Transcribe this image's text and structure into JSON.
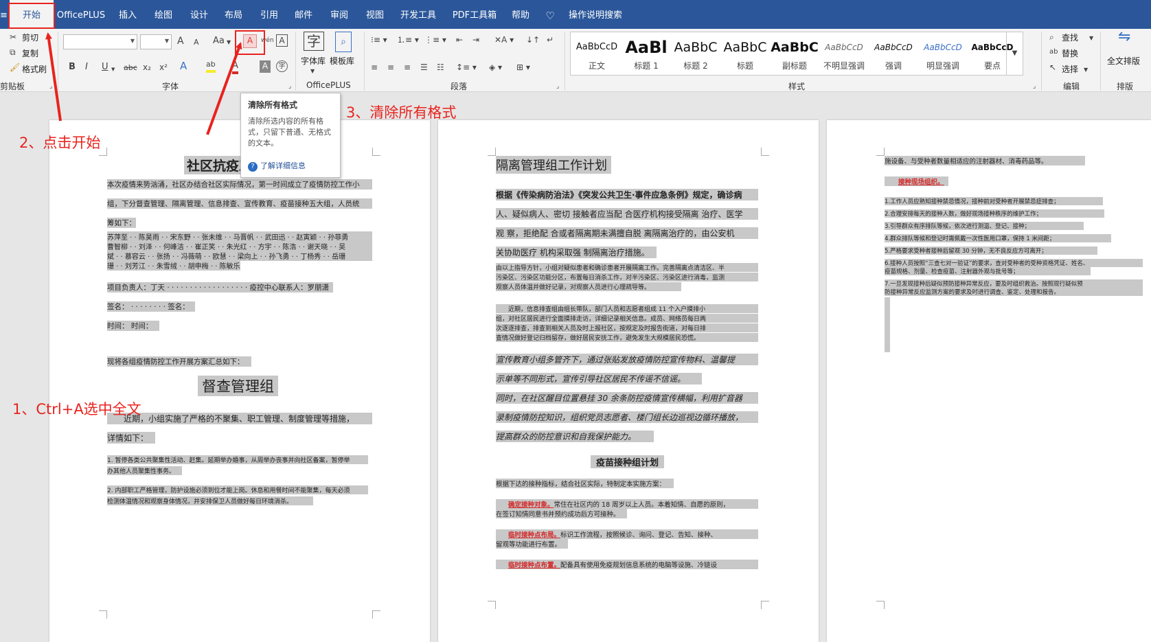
{
  "tabs": [
    "开始",
    "OfficePLUS",
    "插入",
    "绘图",
    "设计",
    "布局",
    "引用",
    "邮件",
    "审阅",
    "视图",
    "开发工具",
    "PDF工具箱",
    "帮助",
    "操作说明搜索"
  ],
  "clipboard": {
    "cut": "剪切",
    "copy": "复制",
    "painter": "格式刷",
    "label": "剪贴板"
  },
  "font": {
    "label": "字体",
    "name_value": "",
    "size_value": "",
    "grow": "A",
    "shrink": "A",
    "case": "Aa",
    "bold": "B",
    "italic": "I",
    "underline": "U",
    "strike": "abc",
    "sub": "x₂",
    "sup": "x²"
  },
  "officeplus": {
    "lib": "字体库",
    "tpl": "模板库",
    "label": "OfficePLUS"
  },
  "paragraph": {
    "label": "段落"
  },
  "styles": {
    "label": "样式",
    "items": [
      {
        "preview": "AaBbCcD",
        "name": "正文"
      },
      {
        "preview": "AaBl",
        "name": "标题 1"
      },
      {
        "preview": "AaBbC",
        "name": "标题 2"
      },
      {
        "preview": "AaBbC",
        "name": "标题"
      },
      {
        "preview": "AaBbC",
        "name": "副标题"
      },
      {
        "preview": "AaBbCcD",
        "name": "不明显强调"
      },
      {
        "preview": "AaBbCcD",
        "name": "强调"
      },
      {
        "preview": "AaBbCcD",
        "name": "明显强调"
      },
      {
        "preview": "AaBbCcD",
        "name": "要点"
      }
    ]
  },
  "editing": {
    "find": "查找",
    "replace": "替换",
    "select": "选择",
    "label": "编辑"
  },
  "layout": {
    "full": "全文排版",
    "label": "排版"
  },
  "tooltip": {
    "title": "清除所有格式",
    "body": "清除所选内容的所有格式，只留下普通、无格式的文本。",
    "link": "了解详细信息"
  },
  "annotations": {
    "step1": "1、Ctrl+A选中全文",
    "step2": "2、点击开始",
    "step3": "3、清除所有格式"
  },
  "page1": {
    "title": "社区抗疫工作手册",
    "lines": [
      "本次疫情来势汹涌，社区办结合社区实际情况，第一时间成立了疫情防控工作小",
      "组，下分督查管理、隔离管理、信息排查、宣传教育、疫苗接种五大组，人员统",
      "筹如下："
    ],
    "names": [
      "苏萍至 · · 陈昊雨 · · 宋东野 · · 张未维 · · 马晋帆 · · 武田迅 · · 赵寅颖 · · 孙菲勇",
      "曹智柳 · · 刘泽 · · 何峰洁 · · 崔正笑 · · 朱光红 · · 方宇 · · 陈浩 · · 谢天晓 · · 吴",
      "斌 · · 慕容云 · · 张扬 · · 冯薇萌 · · 欧慧 · · 梁向上 · · 孙飞勇 · · 丁杨秀 · · 岳珊",
      "珊 · · 刘芳江 · · 朱雪绒 · · 胡申梅 · · 陈敏乐"
    ],
    "project": "项目负责人：丁天 · · · · · · · · · · · · · · · · · · 疫控中心联系人：罗朋潇",
    "sign": "签名： · · · · · · · · 签名：",
    "time": "时间： 时间：",
    "summary": "现将各组疫情防控工作开展方案汇总如下：",
    "group": "督查管理组",
    "intro1": "近期，小组实施了严格的不聚集、职工管理、制度管理等措施，",
    "intro2": "详情如下：",
    "p1a": "1. 暂停各类公共聚集性活动、赶集。延期举办婚事，从周举办丧事并向社区备案，暂停举",
    "p1b": "办其他人员聚集性事务。",
    "p2a": "2. 内部职工严格管理，防护设施必须到位才能上岗。休息和用餐时间不能聚集，每天必须",
    "p2b": "检测体温情况和观察身体情况，并安排保卫人员做好每日环境消杀。"
  },
  "page2": {
    "title": "隔离管理组工作计划",
    "law": [
      "根据《传染病防治法》《突发公共卫生·事件应急条例》规定，确诊病",
      "人、疑似病人、密切 接触者应当配 合医疗机构接受隔离 治疗、医学",
      "观 察，拒绝配 合或者隔离期未满擅自脱 离隔离治疗的，由公安机",
      "关协助医疗 机构采取强 制隔离治疗措施。"
    ],
    "small1": [
      "由以上指导方针，小组对疑似患者和确诊患者开展隔离工作。完善隔离点清洁区、半",
      "污染区、污染区功能分区，布置每日消杀工作，对半污染区、污染区进行消毒，监测",
      "观察人员体温并做好记录，对观察人员进行心理疏导等。"
    ],
    "small2": [
      "近期，信息排查组由组长带队，部门人员和志愿者组成 11 个入户摸排小",
      "组，对社区居民进行全面摸排走访，详细记录相关信息。成员、网络员每日两",
      "次逐逐排查，排查到相关人员及时上报社区，按规定及时报告街道，对每日排",
      "查情况做好登记归档留存，做好居民安抚工作，避免发生大规模居民恐慌。"
    ],
    "italic": [
      "宣传教育小组多管齐下，通过张贴发放疫情防控宣传物料、温馨提",
      "示单等不同形式，宣传引导社区居民不传谣不信谣。",
      "同时，在社区醒目位置悬挂 30 余条防控疫情宣传横幅，利用扩音器",
      "录制疫情防控知识，组织党员志愿者、楼门组长边巡视边循环播放，",
      "提高群众的防控意识和自我保护能力。"
    ],
    "vtitle": "疫苗接种组计划",
    "plan": "根据下达的接种指标，结合社区实际，特制定本实施方案：",
    "r1a": "确定接种对象。",
    "r1b": "常住在社区内的 18 周岁以上人员。本着知情、自愿的原则，",
    "r1c": "在签订知情同意书并预约成功后方可接种。",
    "r2a": "临时接种点布局。",
    "r2b": "标识工作流程，按照候诊、询问、登记、告知、接种、",
    "r2c": "留观等功能进行布置。",
    "r3a": "临时接种点布置。",
    "r3b": "配备具有使用免疫规划信息系统的电脑等设施、冷链设"
  },
  "page3": {
    "top": "施设备、与受种者数量相适应的注射器材、消毒药品等。",
    "org": "接种现场组织。",
    "items": [
      "1.工作人员应熟知接种禁忌情况，接种前对受种者开展禁忌症排查；",
      "2.合理安排每天的接种人数，做好现场接种秩序的维护工作；",
      "3.引导群众有序排队等候，依次进行测温、登记、接种；",
      "4.群众排队等候和登记时需佩戴一次性医用口罩，保持 1 米间距；",
      "5.严格要求受种者接种后留观 30 分钟，无不良反应方可离开；",
      "6.接种人员按照“三查七对一验证”的要求，查对受种者的受种资格凭证、姓名、",
      "疫苗规格、剂量、检查疫苗、注射器外观与批号等；",
      "7.一旦发现接种后疑似预防接种异常反应，要及时组织救治。按照现行疑似预",
      "防接种异常反应监测方案的要求及时进行调查、鉴定、处理和报告。"
    ]
  },
  "colors": {
    "ribbon_blue": "#2b579a",
    "annotation_red": "#e8231e",
    "highlight_gray": "#c8c8c8"
  }
}
